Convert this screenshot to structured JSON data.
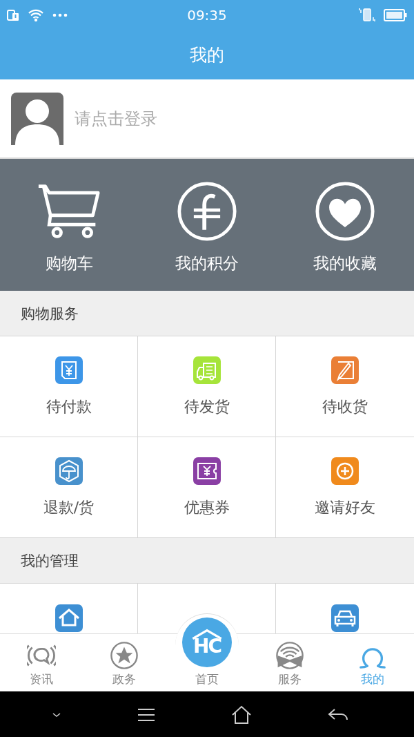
{
  "status_bar": {
    "time": "09:35"
  },
  "title": "我的",
  "login": {
    "prompt": "请点击登录"
  },
  "shortcuts": [
    {
      "label": "购物车"
    },
    {
      "label": "我的积分"
    },
    {
      "label": "我的收藏"
    }
  ],
  "shopping_services": {
    "title": "购物服务",
    "items": [
      {
        "label": "待付款",
        "color": "#3d96e8"
      },
      {
        "label": "待发货",
        "color": "#a6e43a"
      },
      {
        "label": "待收货",
        "color": "#ea7f36"
      },
      {
        "label": "退款/货",
        "color": "#4891cc"
      },
      {
        "label": "优惠券",
        "color": "#8a3fa4"
      },
      {
        "label": "邀请好友",
        "color": "#f08a1c"
      }
    ]
  },
  "my_management": {
    "title": "我的管理"
  },
  "tab_bar": {
    "home": {
      "logo": "HC",
      "label": "首页",
      "selected": false
    },
    "tabs": [
      {
        "label": "资讯",
        "selected": false
      },
      {
        "label": "政务",
        "selected": false
      },
      {
        "label": "服务",
        "selected": false
      },
      {
        "label": "我的",
        "selected": true
      }
    ]
  }
}
